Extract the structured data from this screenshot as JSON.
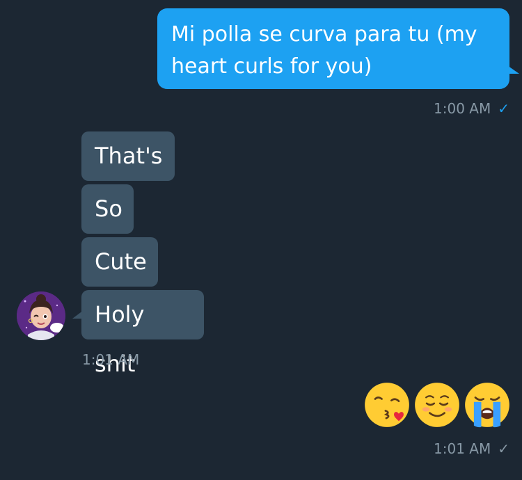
{
  "messages": {
    "outgoing_1": {
      "text": "Mi polla se curva para tu (my heart curls for you)",
      "time": "1:00 AM",
      "status_icon": "check-icon",
      "status_color": "#1da1f2"
    },
    "incoming": {
      "bubbles": [
        "That's",
        "So",
        "Cute",
        "Holy shit"
      ],
      "time": "1:01 AM",
      "avatar": "avatar-cartoon-girl"
    },
    "outgoing_2": {
      "emojis": [
        "kissing-heart-emoji",
        "smiling-blush-emoji",
        "loudly-crying-emoji"
      ],
      "time": "1:01 AM",
      "status_icon": "check-icon",
      "status_color": "#8899a6"
    }
  },
  "colors": {
    "background": "#1c2733",
    "outgoing_bubble": "#1da1f2",
    "incoming_bubble": "#3d5466",
    "meta_text": "#8899a6"
  }
}
